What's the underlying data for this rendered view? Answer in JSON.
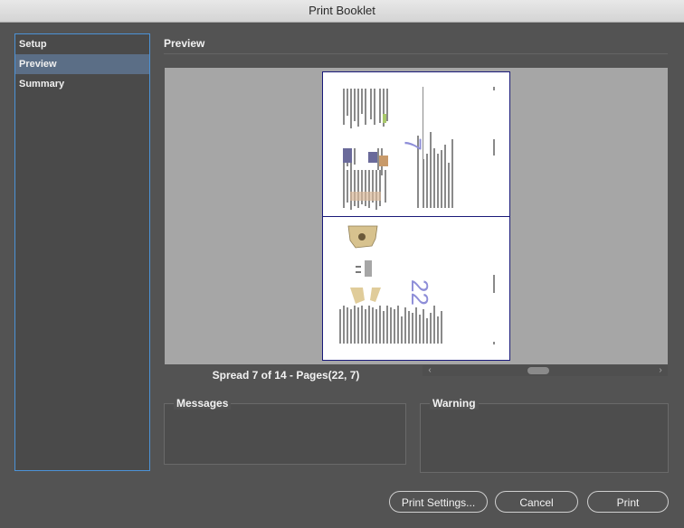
{
  "window": {
    "title": "Print Booklet"
  },
  "sidebar": {
    "items": [
      {
        "label": "Setup",
        "selected": false
      },
      {
        "label": "Preview",
        "selected": true
      },
      {
        "label": "Summary",
        "selected": false
      }
    ]
  },
  "preview": {
    "section_title": "Preview",
    "spread_label": "Spread 7 of 14 - Pages(22, 7)",
    "top_page_number": "7",
    "bottom_page_number": "22"
  },
  "messages": {
    "label": "Messages"
  },
  "warning": {
    "label": "Warning"
  },
  "buttons": {
    "print_settings": "Print Settings...",
    "cancel": "Cancel",
    "print": "Print"
  },
  "colors": {
    "accent": "#4c92d6",
    "selected_row": "#5b6e86",
    "preview_bg": "#a6a6a6",
    "page_number": "#8e8ed8"
  }
}
